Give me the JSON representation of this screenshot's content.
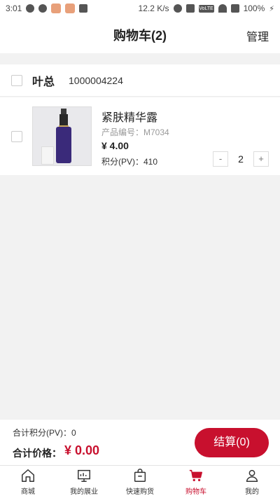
{
  "status_bar": {
    "time": "3:01",
    "net_speed": "12.2 K/s",
    "wifi_tag": "VoLTE",
    "battery": "100%"
  },
  "header": {
    "title": "购物车(2)",
    "manage": "管理"
  },
  "shop": {
    "name": "叶总",
    "id": "1000004224"
  },
  "cart_items": [
    {
      "name": "紧肤精华露",
      "code": "产品编号：M7034",
      "price": "¥ 4.00",
      "pv": "积分(PV)：410",
      "quantity": "2",
      "minus": "-",
      "plus": "+"
    }
  ],
  "summary": {
    "total_pv": "合计积分(PV)：0",
    "total_price_label": "合计价格：",
    "total_price": "¥ 0.00",
    "checkout": "结算(0)"
  },
  "tabbar": [
    {
      "label": "商城",
      "icon": "home-icon"
    },
    {
      "label": "我的展业",
      "icon": "monitor-icon"
    },
    {
      "label": "快速购货",
      "icon": "bag-icon"
    },
    {
      "label": "购物车",
      "icon": "cart-icon",
      "active": true
    },
    {
      "label": "我的",
      "icon": "user-icon"
    }
  ],
  "colors": {
    "accent": "#c8102e",
    "background": "#f2f2f2"
  }
}
